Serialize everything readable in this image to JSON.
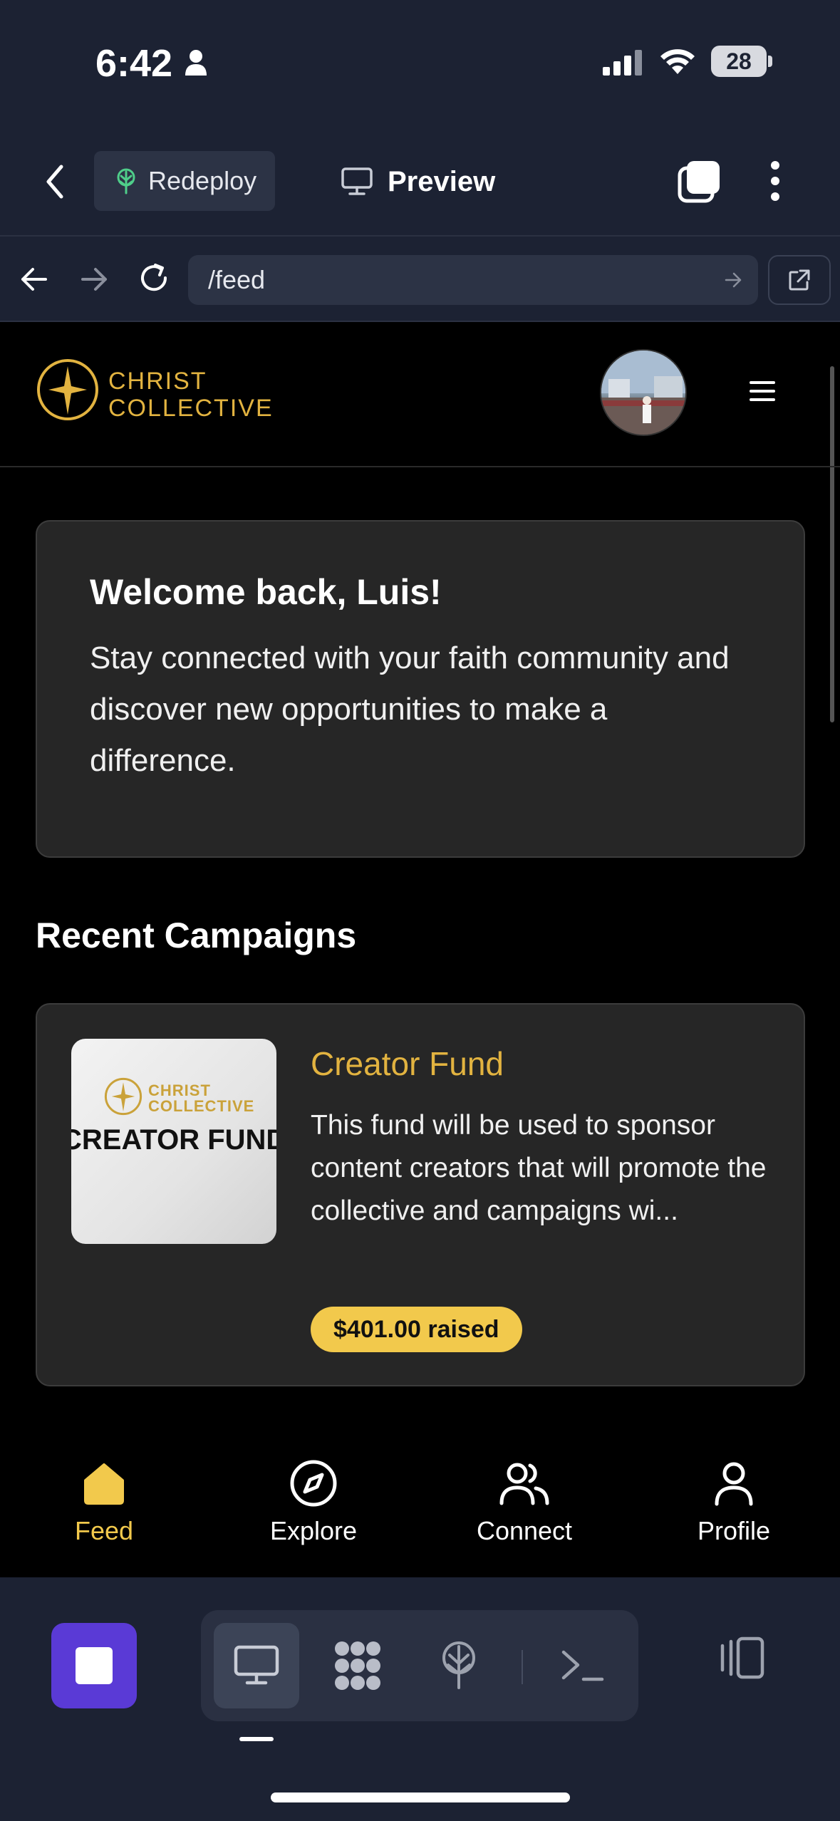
{
  "status_bar": {
    "time": "6:42",
    "battery": "28"
  },
  "toolbar": {
    "redeploy_label": "Redeploy",
    "preview_label": "Preview"
  },
  "url_bar": {
    "url": "/feed"
  },
  "site": {
    "logo_line1": "CHRIST",
    "logo_line2": "COLLECTIVE"
  },
  "welcome": {
    "title": "Welcome back, Luis!",
    "body": "Stay connected with your faith community and discover new opportunities to make a difference."
  },
  "campaigns": {
    "section_title": "Recent Campaigns",
    "items": [
      {
        "thumb_logo_line1": "CHRIST",
        "thumb_logo_line2": "COLLECTIVE",
        "thumb_title": "CREATOR FUND",
        "name": "Creator Fund",
        "description": "This fund will be used to sponsor content creators that will promote the collective and campaigns wi...",
        "raised": "$401.00 raised"
      }
    ]
  },
  "bottom_nav": {
    "items": [
      {
        "label": "Feed",
        "icon": "home-icon",
        "active": true
      },
      {
        "label": "Explore",
        "icon": "compass-icon",
        "active": false
      },
      {
        "label": "Connect",
        "icon": "users-icon",
        "active": false
      },
      {
        "label": "Profile",
        "icon": "user-icon",
        "active": false
      }
    ]
  },
  "colors": {
    "accent": "#f2c94c",
    "brand_gold": "#e2b340",
    "stop_button": "#5a3ad6"
  }
}
